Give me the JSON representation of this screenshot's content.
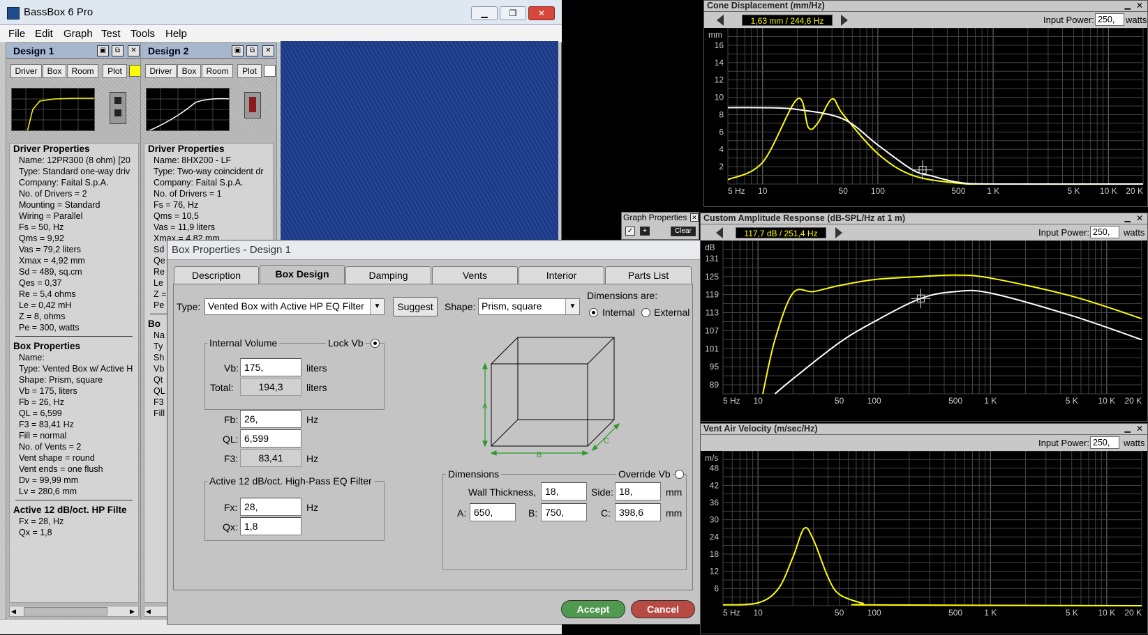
{
  "app": {
    "title": "BassBox 6 Pro",
    "menu": [
      "File",
      "Edit",
      "Graph",
      "Test",
      "Tools",
      "Help"
    ]
  },
  "window_buttons": {
    "minimize": "▁",
    "restore": "❐",
    "close": "✕"
  },
  "design1": {
    "title": "Design 1",
    "buttons": [
      "Driver",
      "Box",
      "Room",
      "Plot"
    ],
    "plot_color": "#ffff00",
    "driver_header": "Driver Properties",
    "driver_lines": [
      "Name: 12PR300  (8 ohm)  [20",
      "Type: Standard one-way driv",
      "Company: Faital S.p.A.",
      "No. of Drivers = 2",
      "Mounting = Standard",
      "Wiring = Parallel",
      "Fs = 50, Hz",
      "Qms = 9,92",
      "Vas = 79,2 liters",
      "Xmax = 4,92 mm",
      "Sd = 489, sq.cm",
      "Qes = 0,37",
      "Re = 5,4 ohms",
      "Le = 0,42 mH",
      "Z = 8, ohms",
      "Pe = 300, watts"
    ],
    "box_header": "Box Properties",
    "box_lines": [
      "Name:",
      "Type: Vented Box w/ Active H",
      "Shape: Prism, square",
      "Vb = 175, liters",
      "Fb = 26, Hz",
      "QL = 6,599",
      "F3 = 83,41 Hz",
      "Fill = normal",
      "No. of Vents = 2",
      "  Vent shape = round",
      "  Vent ends = one flush",
      "  Dv = 99,99 mm",
      "  Lv = 280,6 mm"
    ],
    "filter_header": "Active 12 dB/oct. HP Filte",
    "filter_lines": [
      "Fx = 28, Hz",
      "Qx = 1,8"
    ]
  },
  "design2": {
    "title": "Design 2",
    "buttons": [
      "Driver",
      "Box",
      "Room",
      "Plot"
    ],
    "plot_color": "#ffffff",
    "driver_header": "Driver Properties",
    "driver_lines": [
      "Name: 8HX200 - LF",
      "Type: Two-way coincident dr",
      "Company: Faital S.p.A.",
      "No. of Drivers = 1",
      "Fs = 76, Hz",
      "Qms = 10,5",
      "Vas = 11,9 liters",
      "Xmax = 4,82 mm",
      "Sd",
      "Qe",
      "Re",
      "Le",
      "Z =",
      "Pe"
    ],
    "box_header": "Bo",
    "box_lines": [
      "Na",
      "Ty",
      "Sh",
      "Vb",
      "Qt",
      "QL",
      "F3",
      "Fill"
    ]
  },
  "dialog": {
    "title": "Box Properties - Design 1",
    "tabs": [
      "Description",
      "Box Design",
      "Damping",
      "Vents",
      "Interior",
      "Parts List"
    ],
    "active_tab": "Box Design",
    "type_label": "Type:",
    "type_value": "Vented Box with Active HP EQ Filter",
    "suggest": "Suggest",
    "shape_label": "Shape:",
    "shape_value": "Prism, square",
    "dims_are": "Dimensions are:",
    "internal": "Internal",
    "external": "External",
    "internal_volume": "Internal Volume",
    "lock_vb": "Lock Vb",
    "vb_label": "Vb:",
    "vb": "175,",
    "liters": "liters",
    "total_label": "Total:",
    "total": "194,3",
    "fb_label": "Fb:",
    "fb": "26,",
    "hz": "Hz",
    "ql_label": "QL:",
    "ql": "6,599",
    "f3_label": "F3:",
    "f3": "83,41",
    "filter_group": "Active 12 dB/oct. High-Pass EQ Filter",
    "fx_label": "Fx:",
    "fx": "28,",
    "qx_label": "Qx:",
    "qx": "1,8",
    "dimensions": "Dimensions",
    "override_vb": "Override Vb",
    "wall_label": "Wall Thickness,",
    "wall": "18,",
    "side_label": "Side:",
    "side": "18,",
    "mm": "mm",
    "a_label": "A:",
    "a": "650,",
    "b_label": "B:",
    "b": "750,",
    "c_label": "C:",
    "c": "398,6",
    "box_a": "A",
    "box_b": "B",
    "box_c": "C",
    "accept": "Accept",
    "cancel": "Cancel"
  },
  "graph_properties": {
    "title": "Graph Properties",
    "clear": "Clear"
  },
  "graphs": {
    "cone": {
      "title": "Cone Displacement (mm/Hz)",
      "readout": "1,63 mm / 244,6 Hz",
      "input_power_label": "Input Power:",
      "input_power": "250,",
      "watts": "watts",
      "unit": "mm",
      "yticks": [
        "16",
        "14",
        "12",
        "10",
        "8",
        "6",
        "4",
        "2"
      ],
      "xticks": [
        "5 Hz",
        "10",
        "50",
        "100",
        "500",
        "1 K",
        "5 K",
        "10 K",
        "20 K"
      ]
    },
    "amp": {
      "title": "Custom Amplitude Response (dB-SPL/Hz at 1 m)",
      "readout": "117,7 dB / 251,4 Hz",
      "input_power_label": "Input Power:",
      "input_power": "250,",
      "watts": "watts",
      "unit": "dB",
      "yticks": [
        "131",
        "125",
        "119",
        "113",
        "107",
        "101",
        "95",
        "89"
      ],
      "xticks": [
        "5 Hz",
        "10",
        "50",
        "100",
        "500",
        "1 K",
        "5 K",
        "10 K",
        "20 K"
      ]
    },
    "vent": {
      "title": "Vent Air Velocity (m/sec/Hz)",
      "input_power_label": "Input Power:",
      "input_power": "250,",
      "watts": "watts",
      "unit": "m/s",
      "yticks": [
        "48",
        "42",
        "36",
        "30",
        "24",
        "18",
        "12",
        "6"
      ],
      "xticks": [
        "5 Hz",
        "10",
        "50",
        "100",
        "500",
        "1 K",
        "5 K",
        "10 K",
        "20 K"
      ]
    }
  },
  "chart_data": [
    {
      "type": "line",
      "title": "Cone Displacement (mm/Hz)",
      "ylabel": "mm",
      "x_scale": "log",
      "xlim": [
        5,
        20000
      ],
      "ylim": [
        0,
        18
      ],
      "series": [
        {
          "color": "#ffff00",
          "x": [
            5,
            10,
            20,
            25,
            30,
            40,
            50,
            100,
            200,
            500,
            1000,
            20000
          ],
          "values": [
            0.5,
            2.5,
            9.8,
            6.5,
            7,
            9.8,
            8,
            3.5,
            1,
            0.1,
            0,
            0
          ]
        },
        {
          "color": "#ffffff",
          "x": [
            5,
            10,
            20,
            50,
            100,
            200,
            300,
            500,
            1000,
            20000
          ],
          "values": [
            8.8,
            8.8,
            8.6,
            7.5,
            4.5,
            1.63,
            0.9,
            0.2,
            0,
            0
          ]
        }
      ]
    },
    {
      "type": "line",
      "title": "Custom Amplitude Response (dB-SPL/Hz at 1 m)",
      "ylabel": "dB",
      "x_scale": "log",
      "xlim": [
        5,
        20000
      ],
      "ylim": [
        86,
        137
      ],
      "series": [
        {
          "color": "#ffff00",
          "x": [
            11,
            14,
            20,
            30,
            50,
            100,
            250,
            500,
            1000,
            5000,
            20000
          ],
          "values": [
            86,
            104,
            119.5,
            120,
            122,
            124,
            125,
            125.5,
            124.5,
            118.5,
            111
          ]
        },
        {
          "color": "#ffffff",
          "x": [
            14,
            20,
            50,
            100,
            250,
            500,
            1000,
            5000,
            20000
          ],
          "values": [
            86,
            91,
            103,
            110,
            117.7,
            120,
            119.5,
            112,
            104
          ]
        }
      ]
    },
    {
      "type": "line",
      "title": "Vent Air Velocity (m/sec/Hz)",
      "ylabel": "m/s",
      "x_scale": "log",
      "xlim": [
        5,
        20000
      ],
      "ylim": [
        0,
        54
      ],
      "series": [
        {
          "color": "#ffff00",
          "x": [
            5,
            10,
            15,
            20,
            25,
            30,
            40,
            50,
            80,
            100,
            20000
          ],
          "values": [
            0.3,
            1,
            6,
            17,
            27,
            23,
            10,
            4,
            0.8,
            0.3,
            0
          ]
        }
      ]
    }
  ]
}
